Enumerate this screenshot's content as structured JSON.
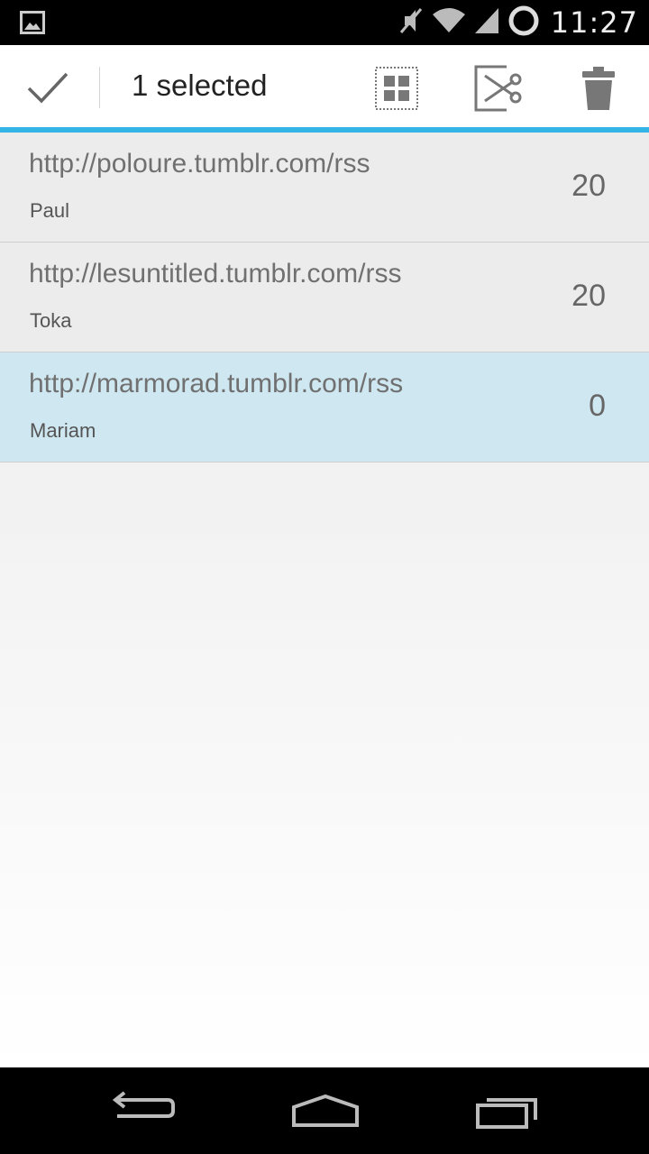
{
  "status_bar": {
    "time": "11:27",
    "icons": [
      "gallery-icon",
      "mute-icon",
      "wifi-icon",
      "signal-icon",
      "battery-icon"
    ]
  },
  "action_bar": {
    "title": "1 selected",
    "actions": [
      "done",
      "select-all",
      "cut",
      "delete"
    ],
    "accent_color": "#33b5e5"
  },
  "feeds": [
    {
      "url": "http://poloure.tumblr.com/rss",
      "name": "Paul",
      "count": "20",
      "selected": false
    },
    {
      "url": "http://lesuntitled.tumblr.com/rss",
      "name": "Toka",
      "count": "20",
      "selected": false
    },
    {
      "url": "http://marmorad.tumblr.com/rss",
      "name": "Mariam",
      "count": "0",
      "selected": true
    }
  ],
  "nav_bar": {
    "buttons": [
      "back-icon",
      "home-icon",
      "recent-apps-icon"
    ]
  },
  "colors": {
    "selected_row": "#cfe7f1",
    "row": "#ececec"
  }
}
